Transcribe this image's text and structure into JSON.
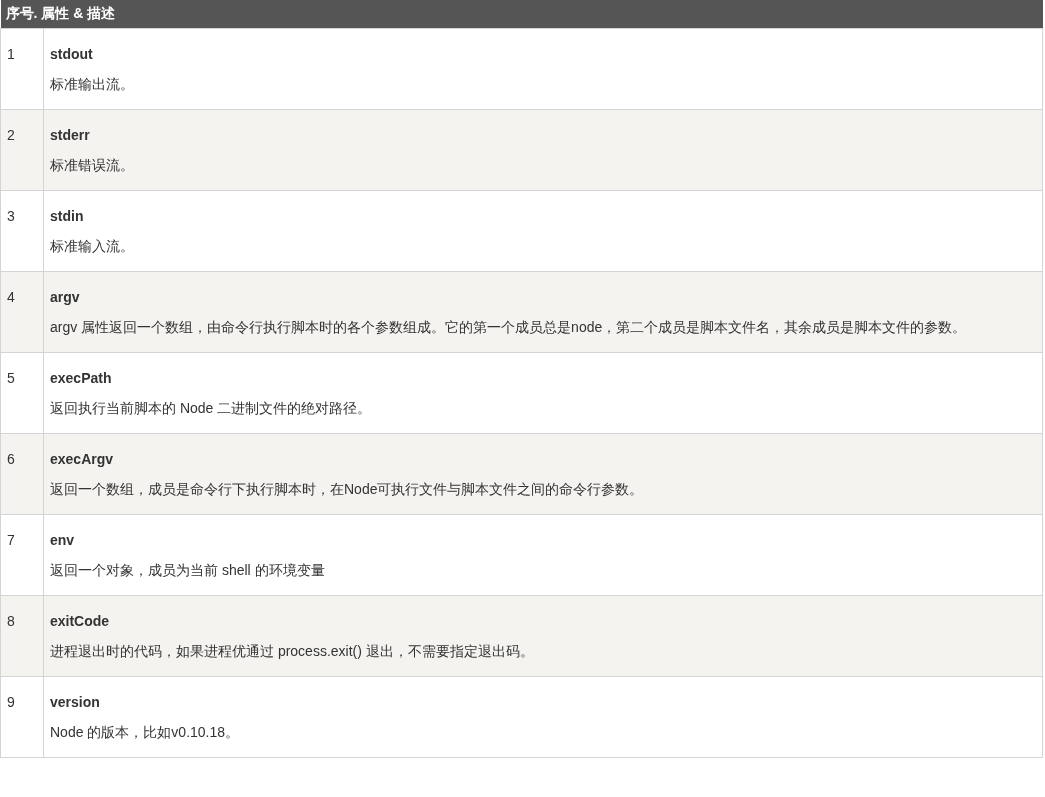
{
  "table": {
    "header": "序号. 属性 & 描述",
    "rows": [
      {
        "number": "1",
        "name": "stdout",
        "description": "标准输出流。"
      },
      {
        "number": "2",
        "name": "stderr",
        "description": "标准错误流。"
      },
      {
        "number": "3",
        "name": "stdin",
        "description": "标准输入流。"
      },
      {
        "number": "4",
        "name": "argv",
        "description": "argv 属性返回一个数组，由命令行执行脚本时的各个参数组成。它的第一个成员总是node，第二个成员是脚本文件名，其余成员是脚本文件的参数。"
      },
      {
        "number": "5",
        "name": "execPath",
        "description": "返回执行当前脚本的 Node 二进制文件的绝对路径。"
      },
      {
        "number": "6",
        "name": "execArgv",
        "description": "返回一个数组，成员是命令行下执行脚本时，在Node可执行文件与脚本文件之间的命令行参数。"
      },
      {
        "number": "7",
        "name": "env",
        "description": "返回一个对象，成员为当前 shell 的环境变量"
      },
      {
        "number": "8",
        "name": "exitCode",
        "description": "进程退出时的代码，如果进程优通过 process.exit() 退出，不需要指定退出码。"
      },
      {
        "number": "9",
        "name": "version",
        "description": "Node 的版本，比如v0.10.18。"
      }
    ]
  }
}
